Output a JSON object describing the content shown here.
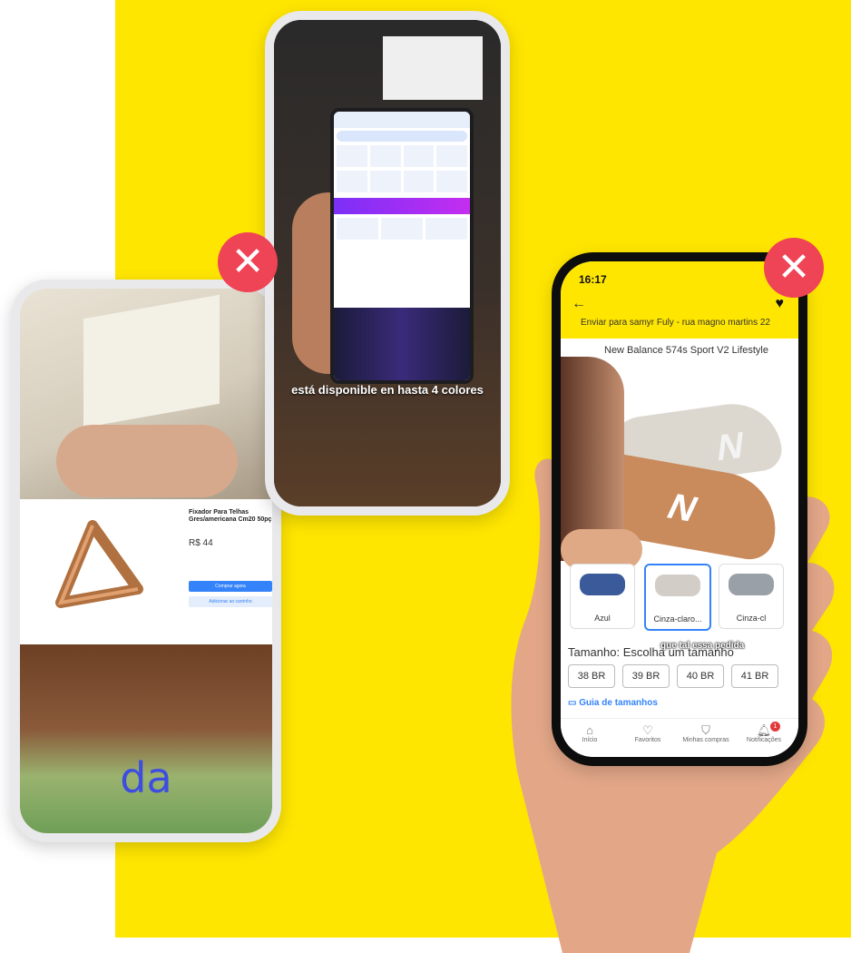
{
  "colors": {
    "background_yellow": "#FFE600",
    "badge_red": "#EF4356",
    "accent_blue": "#3483FA",
    "caption_blue": "#3D4DE0"
  },
  "phone_left": {
    "listing": {
      "title": "Fixador Para Telhas Gres/americana Cm20 50pç",
      "price": "R$ 44",
      "buy_button": "Comprar agora",
      "cart_button": "Adicionar ao carrinho"
    },
    "caption": "da"
  },
  "phone_middle": {
    "caption": "está disponible en hasta 4 colores"
  },
  "phone_right": {
    "status_time": "16:17",
    "shipping": "Enviar para samyr Fuly - rua magno martins 22",
    "product_title": "New Balance 574s Sport V2 Lifestyle",
    "variants": [
      "Azul",
      "Cinza-claro...",
      "Cinza-cl"
    ],
    "size_label": "Tamanho: Escolha um tamanho",
    "video_caption": "que tal essa pedida",
    "sizes": [
      "38 BR",
      "39 BR",
      "40 BR",
      "41 BR"
    ],
    "size_guide": "Guia de tamanhos",
    "tabs": [
      "Início",
      "Favoritos",
      "Minhas compras",
      "Notificações"
    ],
    "notification_count": "1"
  },
  "badges": {
    "close_symbol": "✕"
  }
}
